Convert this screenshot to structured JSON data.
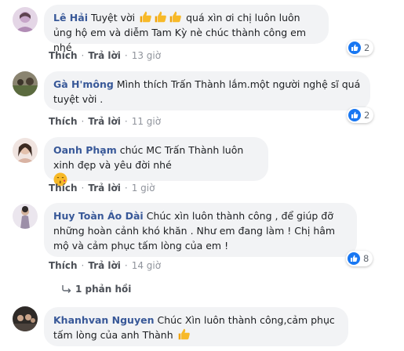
{
  "comments": [
    {
      "author": "Lê Hải",
      "text_before": "Tuyệt vời",
      "text_after": "quá xìn ơi chị luôn luôn ủng hộ em và diễm Tam Kỳ nè chúc thành công em nhé",
      "actions": {
        "like": "Thích",
        "reply": "Trả lời",
        "time": "13 giờ"
      },
      "reaction_count": "2",
      "avatar_color": "#c7a6c9"
    },
    {
      "author": "Gà H'mông",
      "text": "Mình thích Trấn Thành lắm.một người nghệ sĩ quá tuyệt vời .",
      "actions": {
        "like": "Thích",
        "reply": "Trả lời",
        "time": "11 giờ"
      },
      "reaction_count": "2",
      "avatar_color": "#6f6a5a"
    },
    {
      "author": "Oanh Phạm",
      "text": "chúc MC Trấn Thành luôn xinh đẹp và yêu đời nhé",
      "emoji": "kiss-face-icon",
      "actions": {
        "like": "Thích",
        "reply": "Trả lời",
        "time": "1 giờ"
      },
      "avatar_color": "#d9b3a3"
    },
    {
      "author": "Huy Toàn Áo Dài",
      "text": "Chúc xìn luôn thành công , để giúp đỡ những hoàn cảnh khó khăn . Như em đang làm ! Chị hâm mộ và cảm phục tấm lòng của em !",
      "actions": {
        "like": "Thích",
        "reply": "Trả lời",
        "time": "14 giờ"
      },
      "reaction_count": "8",
      "replies_label": "1 phản hồi",
      "avatar_color": "#9c8fa8"
    },
    {
      "author": "Khanhvan Nguyen",
      "text": "Chúc Xìn luôn thành công,cảm phục tấm lòng của anh Thành",
      "avatar_color": "#3f3a36"
    }
  ],
  "icons": {
    "like": "like-icon",
    "thumbs_up": "thumbs-up-emoji-icon",
    "reply": "reply-arrow-icon"
  },
  "colors": {
    "author": "#385898",
    "bubble": "#f2f3f5",
    "like_blue": "#1877f2",
    "emoji_yellow": "#f7b928"
  }
}
